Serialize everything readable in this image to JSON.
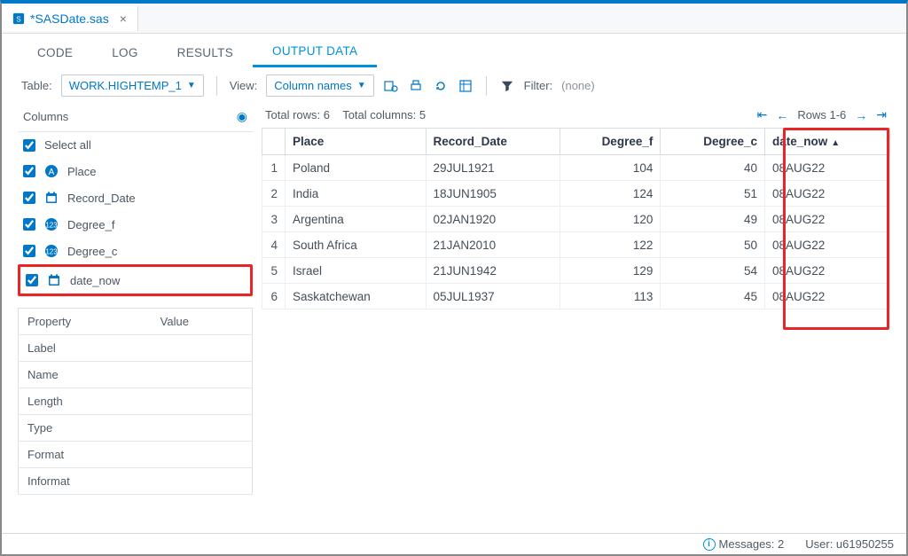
{
  "file_tab": {
    "filename": "*SASDate.sas"
  },
  "nav": {
    "code": "CODE",
    "log": "LOG",
    "results": "RESULTS",
    "output_data": "OUTPUT DATA"
  },
  "toolbar": {
    "table_label": "Table:",
    "table_value": "WORK.HIGHTEMP_1",
    "view_label": "View:",
    "view_value": "Column names",
    "filter_label": "Filter:",
    "filter_value": "(none)"
  },
  "columns_panel": {
    "header": "Columns",
    "select_all": "Select all",
    "items": [
      {
        "label": "Place",
        "type": "char"
      },
      {
        "label": "Record_Date",
        "type": "date"
      },
      {
        "label": "Degree_f",
        "type": "num"
      },
      {
        "label": "Degree_c",
        "type": "num"
      },
      {
        "label": "date_now",
        "type": "date"
      }
    ],
    "props": {
      "header_prop": "Property",
      "header_val": "Value",
      "rows": [
        "Label",
        "Name",
        "Length",
        "Type",
        "Format",
        "Informat"
      ]
    }
  },
  "data_summary": {
    "total_rows_label": "Total rows: 6",
    "total_cols_label": "Total columns: 5",
    "rows_range": "Rows 1-6"
  },
  "table": {
    "headers": {
      "place": "Place",
      "record_date": "Record_Date",
      "degree_f": "Degree_f",
      "degree_c": "Degree_c",
      "date_now": "date_now"
    },
    "rows": [
      {
        "n": "1",
        "place": "Poland",
        "record_date": "29JUL1921",
        "degree_f": "104",
        "degree_c": "40",
        "date_now": "08AUG22"
      },
      {
        "n": "2",
        "place": "India",
        "record_date": "18JUN1905",
        "degree_f": "124",
        "degree_c": "51",
        "date_now": "08AUG22"
      },
      {
        "n": "3",
        "place": "Argentina",
        "record_date": "02JAN1920",
        "degree_f": "120",
        "degree_c": "49",
        "date_now": "08AUG22"
      },
      {
        "n": "4",
        "place": "South Africa",
        "record_date": "21JAN2010",
        "degree_f": "122",
        "degree_c": "50",
        "date_now": "08AUG22"
      },
      {
        "n": "5",
        "place": "Israel",
        "record_date": "21JUN1942",
        "degree_f": "129",
        "degree_c": "54",
        "date_now": "08AUG22"
      },
      {
        "n": "6",
        "place": "Saskatchewan",
        "record_date": "05JUL1937",
        "degree_f": "113",
        "degree_c": "45",
        "date_now": "08AUG22"
      }
    ]
  },
  "status": {
    "messages_label": "Messages: 2",
    "user_label": "User: u61950255"
  }
}
